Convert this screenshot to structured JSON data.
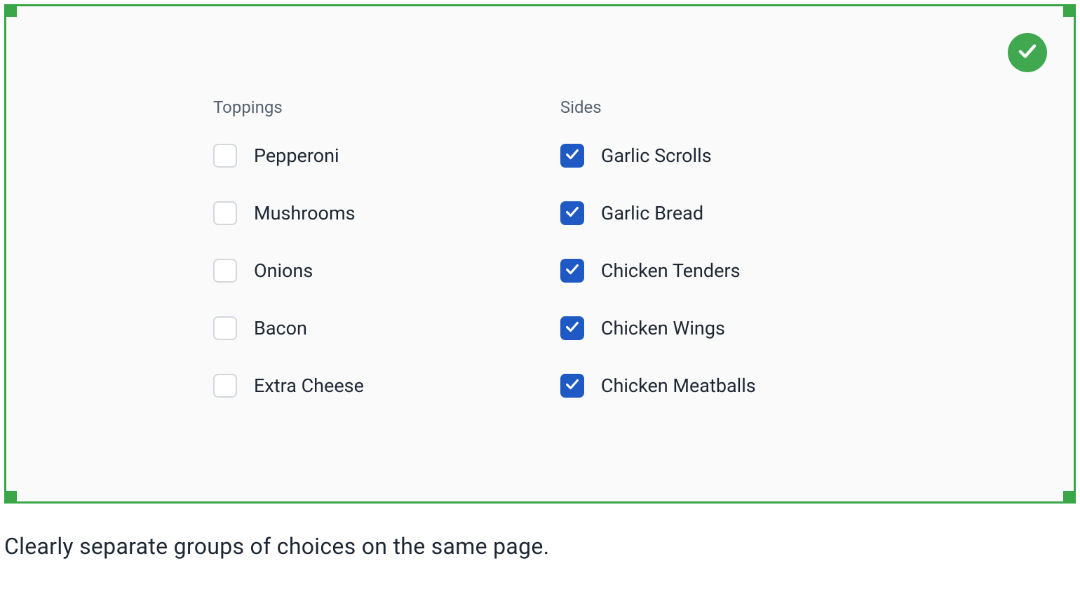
{
  "groups": [
    {
      "heading": "Toppings",
      "options": [
        {
          "label": "Pepperoni",
          "checked": false
        },
        {
          "label": "Mushrooms",
          "checked": false
        },
        {
          "label": "Onions",
          "checked": false
        },
        {
          "label": "Bacon",
          "checked": false
        },
        {
          "label": "Extra Cheese",
          "checked": false
        }
      ]
    },
    {
      "heading": "Sides",
      "options": [
        {
          "label": "Garlic Scrolls",
          "checked": true
        },
        {
          "label": "Garlic Bread",
          "checked": true
        },
        {
          "label": "Chicken Tenders",
          "checked": true
        },
        {
          "label": "Chicken Wings",
          "checked": true
        },
        {
          "label": "Chicken Meatballs",
          "checked": true
        }
      ]
    }
  ],
  "caption": "Clearly separate groups of choices on the same page.",
  "colors": {
    "frame_border": "#3aa648",
    "success_badge": "#40a84e",
    "checkbox_checked": "#1f59c4",
    "checkbox_unchecked_border": "#d4d8dd",
    "text_primary": "#1d2733",
    "text_secondary": "#556070",
    "panel_bg": "#fafafa"
  }
}
